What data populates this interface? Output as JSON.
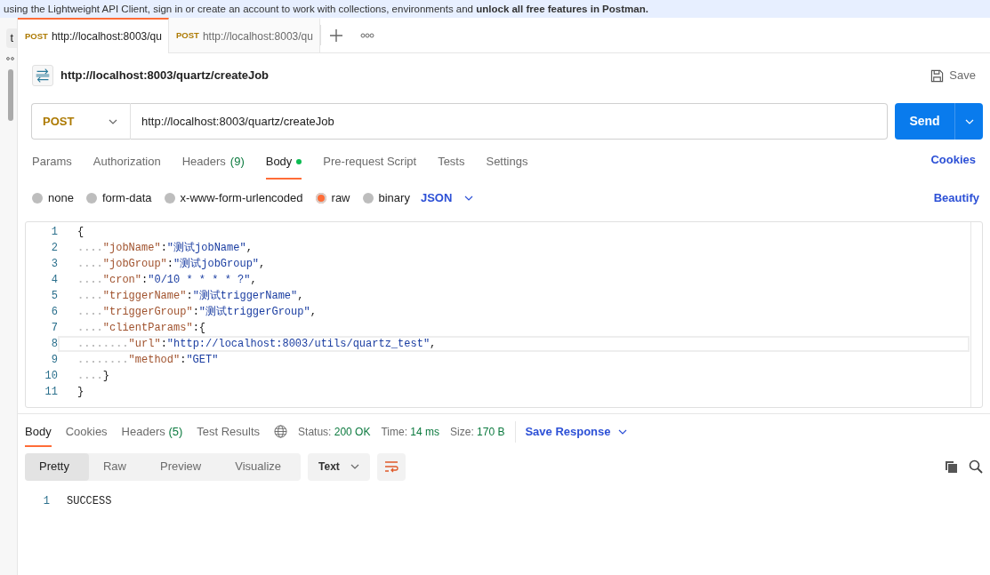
{
  "banner": {
    "text": "using the Lightweight API Client, sign in or create an account to work with collections, environments and **unlock all free features in Postman.**"
  },
  "sidebar": {
    "button": "t"
  },
  "tabs": [
    {
      "method": "POST",
      "label": "http://localhost:8003/qu",
      "selected": true
    },
    {
      "method": "POST",
      "label": "http://localhost:8003/qu",
      "selected": false
    }
  ],
  "request": {
    "title": "http://localhost:8003/quartz/createJob",
    "save": "Save",
    "method": "POST",
    "url": "http://localhost:8003/quartz/createJob",
    "send": "Send"
  },
  "request_tabs": [
    {
      "label": "Params",
      "selected": false,
      "has_content": false
    },
    {
      "label": "Authorization",
      "selected": false,
      "has_content": false
    },
    {
      "label": "Headers",
      "count": "(9)",
      "selected": false,
      "has_content": false
    },
    {
      "label": "Body",
      "selected": true,
      "has_content": true
    },
    {
      "label": "Pre-request Script",
      "selected": false,
      "has_content": false
    },
    {
      "label": "Tests",
      "selected": false,
      "has_content": false
    },
    {
      "label": "Settings",
      "selected": false,
      "has_content": false
    }
  ],
  "cookies_link": "Cookies",
  "body_types": [
    {
      "label": "none",
      "selected": false
    },
    {
      "label": "form-data",
      "selected": false
    },
    {
      "label": "x-www-form-urlencoded",
      "selected": false
    },
    {
      "label": "raw",
      "selected": true
    },
    {
      "label": "binary",
      "selected": false
    }
  ],
  "language": "JSON",
  "beautify": "Beautify",
  "code_lines": [
    {
      "number": "1",
      "text": "{",
      "active": false
    },
    {
      "number": "2",
      "text": "    \"jobName\":\"测试jobName\",",
      "active": false
    },
    {
      "number": "3",
      "text": "    \"jobGroup\":\"测试jobGroup\",",
      "active": false
    },
    {
      "number": "4",
      "text": "    \"cron\":\"0/10 * * * * ?\",",
      "active": false
    },
    {
      "number": "5",
      "text": "    \"triggerName\":\"测试triggerName\",",
      "active": false
    },
    {
      "number": "6",
      "text": "    \"triggerGroup\":\"测试triggerGroup\",",
      "active": false
    },
    {
      "number": "7",
      "text": "    \"clientParams\":{",
      "active": false
    },
    {
      "number": "8",
      "text": "        \"url\":\"http://localhost:8003/utils/quartz_test\",",
      "active": true
    },
    {
      "number": "9",
      "text": "        \"method\":\"GET\"",
      "active": false
    },
    {
      "number": "10",
      "text": "    }",
      "active": false
    },
    {
      "number": "11",
      "text": "}",
      "active": false
    }
  ],
  "response": {
    "tabs": [
      {
        "label": "Body",
        "selected": true
      },
      {
        "label": "Cookies",
        "selected": false
      },
      {
        "label": "Headers",
        "count": "(5)",
        "selected": false
      },
      {
        "label": "Test Results",
        "selected": false
      }
    ],
    "status_label": "Status:",
    "status": "200 OK",
    "time_label": "Time:",
    "time": "14 ms",
    "size_label": "Size:",
    "size": "170 B",
    "save_response": "Save Response",
    "views": [
      {
        "label": "Pretty",
        "selected": true
      },
      {
        "label": "Raw",
        "selected": false
      },
      {
        "label": "Preview",
        "selected": false
      },
      {
        "label": "Visualize",
        "selected": false
      }
    ],
    "format": "Text",
    "lines": [
      {
        "number": "1",
        "text": "SUCCESS"
      }
    ]
  }
}
